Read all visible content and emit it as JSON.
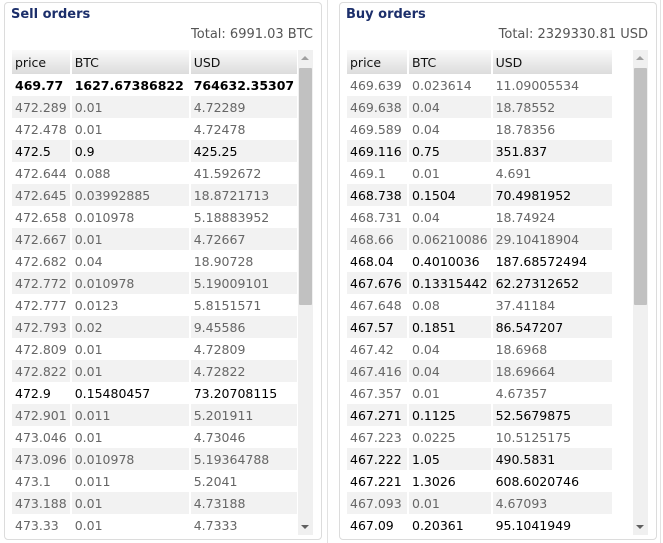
{
  "sell": {
    "title": "Sell orders",
    "total": "Total: 6991.03 BTC",
    "columns": [
      "price",
      "BTC",
      "USD"
    ],
    "scroll_position": 0,
    "rows": [
      {
        "price": "469.77",
        "btc": "1627.67386822",
        "usd": "764632.35307",
        "strong": true
      },
      {
        "price": "472.289",
        "btc": "0.01",
        "usd": "4.72289"
      },
      {
        "price": "472.478",
        "btc": "0.01",
        "usd": "4.72478"
      },
      {
        "price": "472.5",
        "btc": "0.9",
        "usd": "425.25",
        "large": true
      },
      {
        "price": "472.644",
        "btc": "0.088",
        "usd": "41.592672"
      },
      {
        "price": "472.645",
        "btc": "0.03992885",
        "usd": "18.8721713"
      },
      {
        "price": "472.658",
        "btc": "0.010978",
        "usd": "5.18883952"
      },
      {
        "price": "472.667",
        "btc": "0.01",
        "usd": "4.72667"
      },
      {
        "price": "472.682",
        "btc": "0.04",
        "usd": "18.90728"
      },
      {
        "price": "472.772",
        "btc": "0.010978",
        "usd": "5.19009101"
      },
      {
        "price": "472.777",
        "btc": "0.0123",
        "usd": "5.8151571"
      },
      {
        "price": "472.793",
        "btc": "0.02",
        "usd": "9.45586"
      },
      {
        "price": "472.809",
        "btc": "0.01",
        "usd": "4.72809"
      },
      {
        "price": "472.822",
        "btc": "0.01",
        "usd": "4.72822"
      },
      {
        "price": "472.9",
        "btc": "0.15480457",
        "usd": "73.20708115",
        "large": true
      },
      {
        "price": "472.901",
        "btc": "0.011",
        "usd": "5.201911"
      },
      {
        "price": "473.046",
        "btc": "0.01",
        "usd": "4.73046"
      },
      {
        "price": "473.096",
        "btc": "0.010978",
        "usd": "5.19364788"
      },
      {
        "price": "473.1",
        "btc": "0.011",
        "usd": "5.2041"
      },
      {
        "price": "473.188",
        "btc": "0.01",
        "usd": "4.73188"
      },
      {
        "price": "473.33",
        "btc": "0.01",
        "usd": "4.7333"
      }
    ]
  },
  "buy": {
    "title": "Buy orders",
    "total": "Total: 2329330.81 USD",
    "columns": [
      "price",
      "BTC",
      "USD"
    ],
    "scroll_position": 0,
    "rows": [
      {
        "price": "469.639",
        "btc": "0.023614",
        "usd": "11.09005534"
      },
      {
        "price": "469.638",
        "btc": "0.04",
        "usd": "18.78552"
      },
      {
        "price": "469.589",
        "btc": "0.04",
        "usd": "18.78356"
      },
      {
        "price": "469.116",
        "btc": "0.75",
        "usd": "351.837",
        "large": true
      },
      {
        "price": "469.1",
        "btc": "0.01",
        "usd": "4.691"
      },
      {
        "price": "468.738",
        "btc": "0.1504",
        "usd": "70.4981952",
        "large": true
      },
      {
        "price": "468.731",
        "btc": "0.04",
        "usd": "18.74924"
      },
      {
        "price": "468.66",
        "btc": "0.06210086",
        "usd": "29.10418904"
      },
      {
        "price": "468.04",
        "btc": "0.4010036",
        "usd": "187.68572494",
        "large": true
      },
      {
        "price": "467.676",
        "btc": "0.13315442",
        "usd": "62.27312652",
        "large": true
      },
      {
        "price": "467.648",
        "btc": "0.08",
        "usd": "37.41184"
      },
      {
        "price": "467.57",
        "btc": "0.1851",
        "usd": "86.547207",
        "large": true
      },
      {
        "price": "467.42",
        "btc": "0.04",
        "usd": "18.6968"
      },
      {
        "price": "467.416",
        "btc": "0.04",
        "usd": "18.69664"
      },
      {
        "price": "467.357",
        "btc": "0.01",
        "usd": "4.67357"
      },
      {
        "price": "467.271",
        "btc": "0.1125",
        "usd": "52.5679875",
        "large": true
      },
      {
        "price": "467.223",
        "btc": "0.0225",
        "usd": "10.5125175"
      },
      {
        "price": "467.222",
        "btc": "1.05",
        "usd": "490.5831",
        "large": true
      },
      {
        "price": "467.221",
        "btc": "1.3026",
        "usd": "608.6020746",
        "large": true
      },
      {
        "price": "467.093",
        "btc": "0.01",
        "usd": "4.67093"
      },
      {
        "price": "467.09",
        "btc": "0.20361",
        "usd": "95.1041949",
        "large": true
      }
    ]
  }
}
